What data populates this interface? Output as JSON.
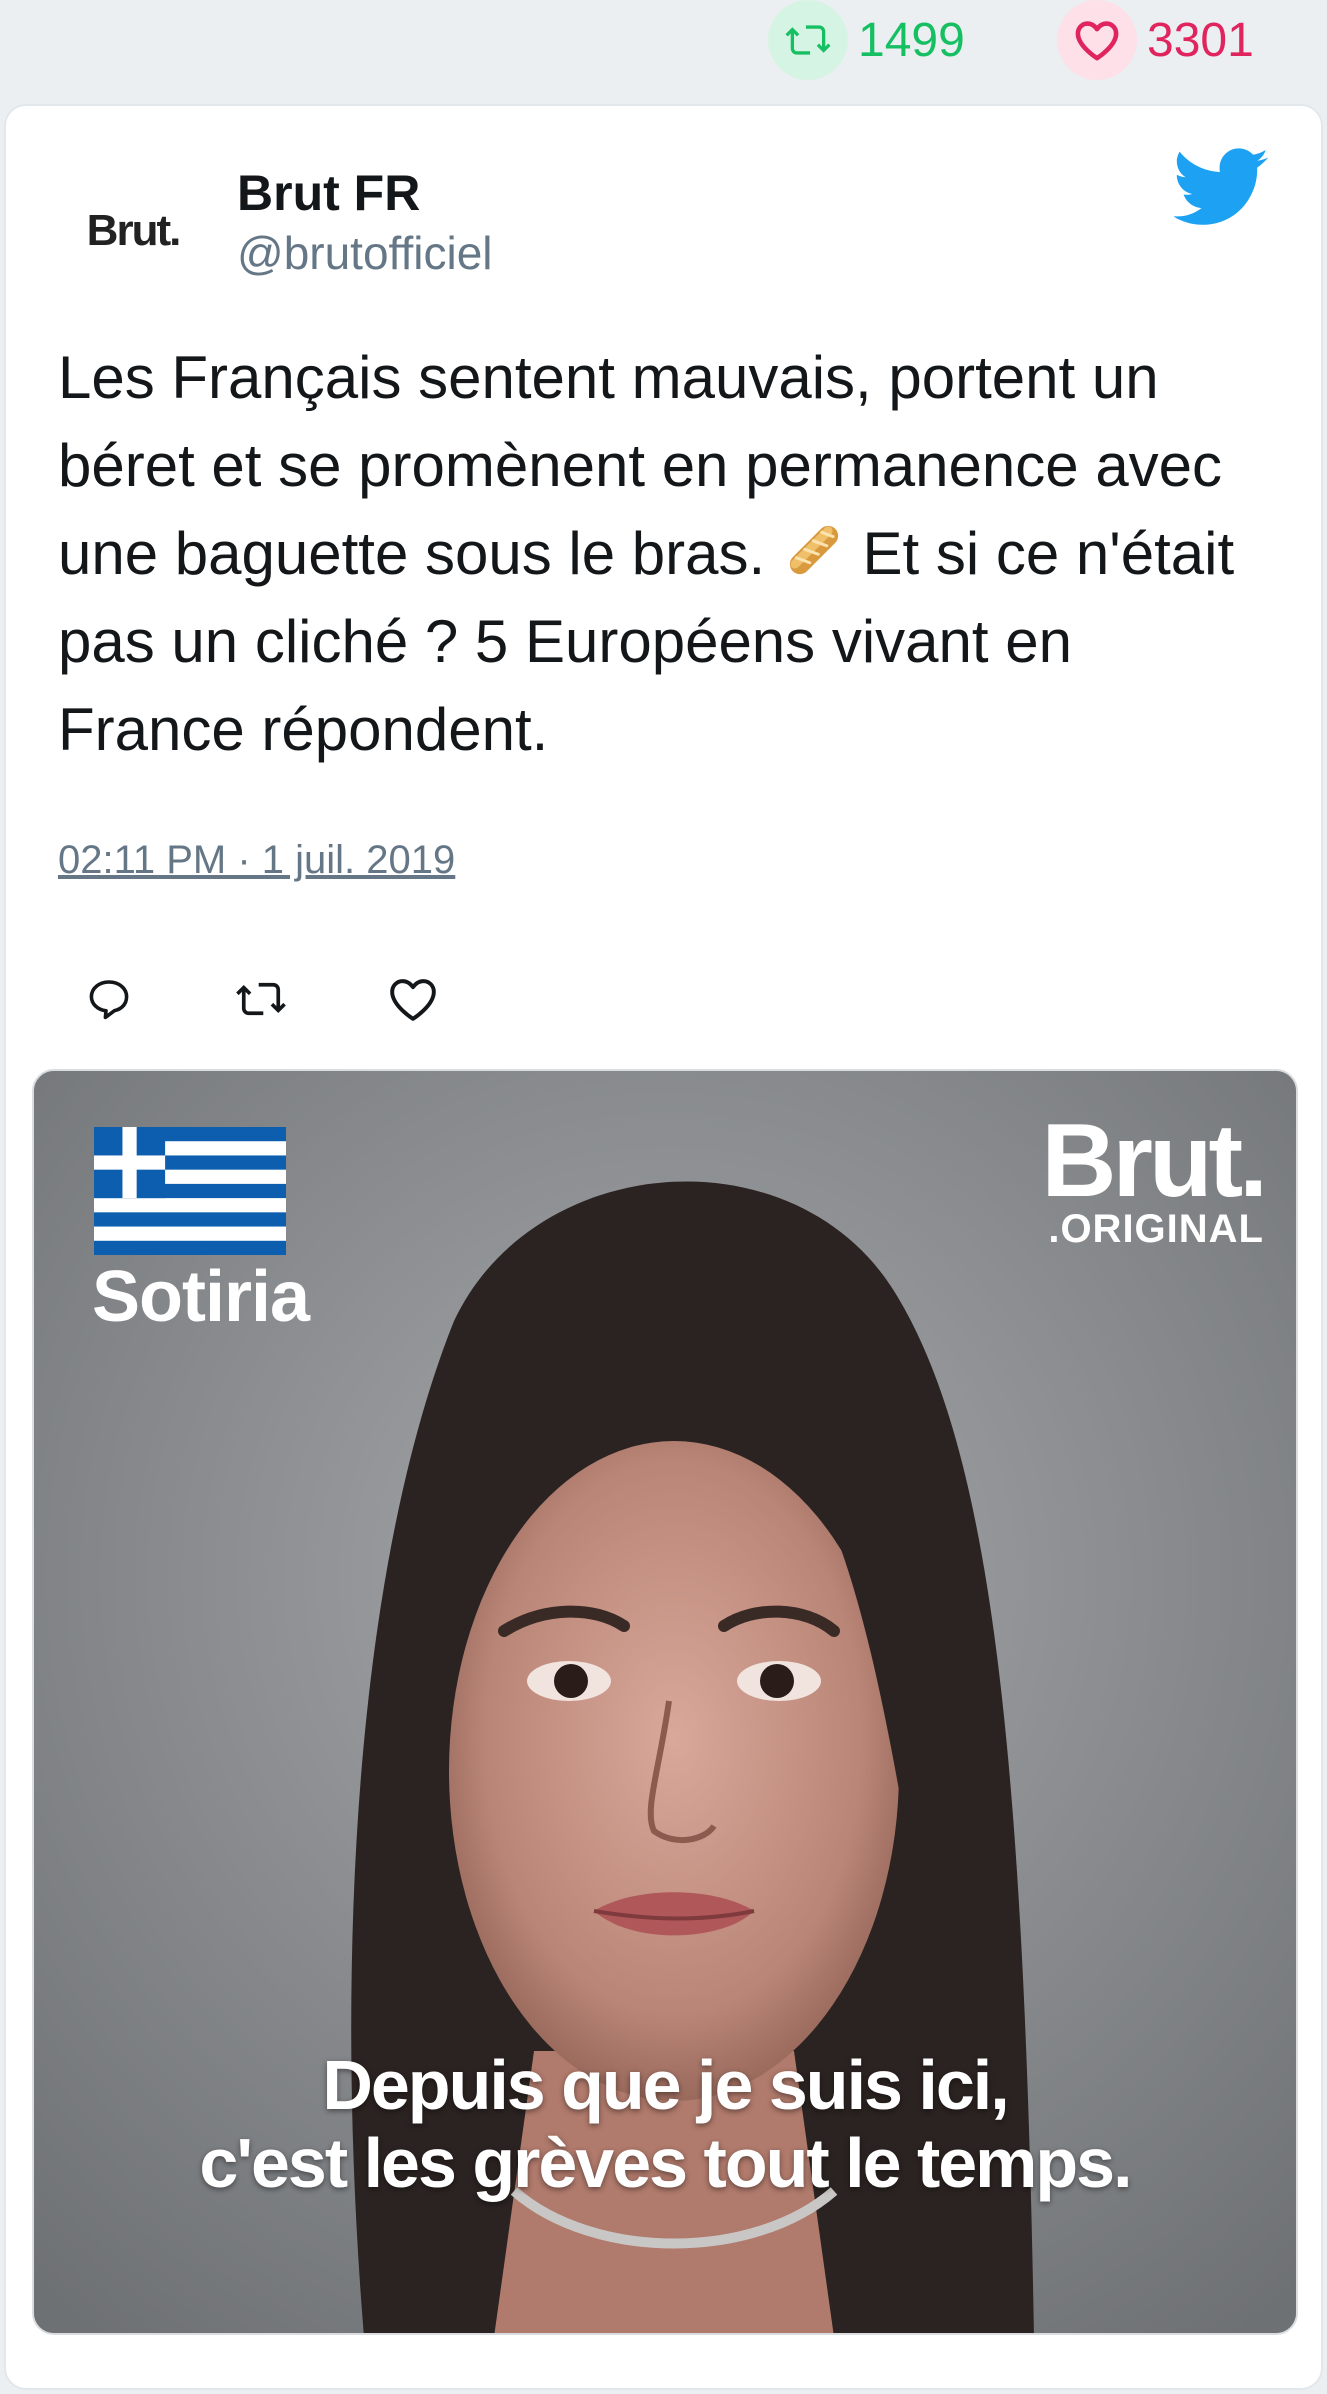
{
  "stats": {
    "retweets": "1499",
    "likes": "3301",
    "retweet_color": "#17bf63",
    "like_color": "#e0245e"
  },
  "tweet": {
    "avatar_text": "Brut.",
    "author_name": "Brut FR",
    "handle": "@brutofficiel",
    "text_part1": "Les Français sentent mauvais, portent un béret et se promènent en permanence avec une baguette sous le bras.",
    "emoji": "baguette-bread",
    "text_part2": "Et si ce n'était pas un cliché ? 5 Européens vivant en France répondent.",
    "timestamp": "02:11 PM · 1 juil. 2019",
    "brand_icon": "twitter-bird-icon",
    "accent": "#1da1f2"
  },
  "media": {
    "person_name": "Sotiria",
    "flag": "greece-flag",
    "logo_big": "Brut.",
    "logo_small": ".ORIGINAL",
    "subtitle_line1": "Depuis que je suis ici,",
    "subtitle_line2": "c'est les grèves tout le temps."
  }
}
